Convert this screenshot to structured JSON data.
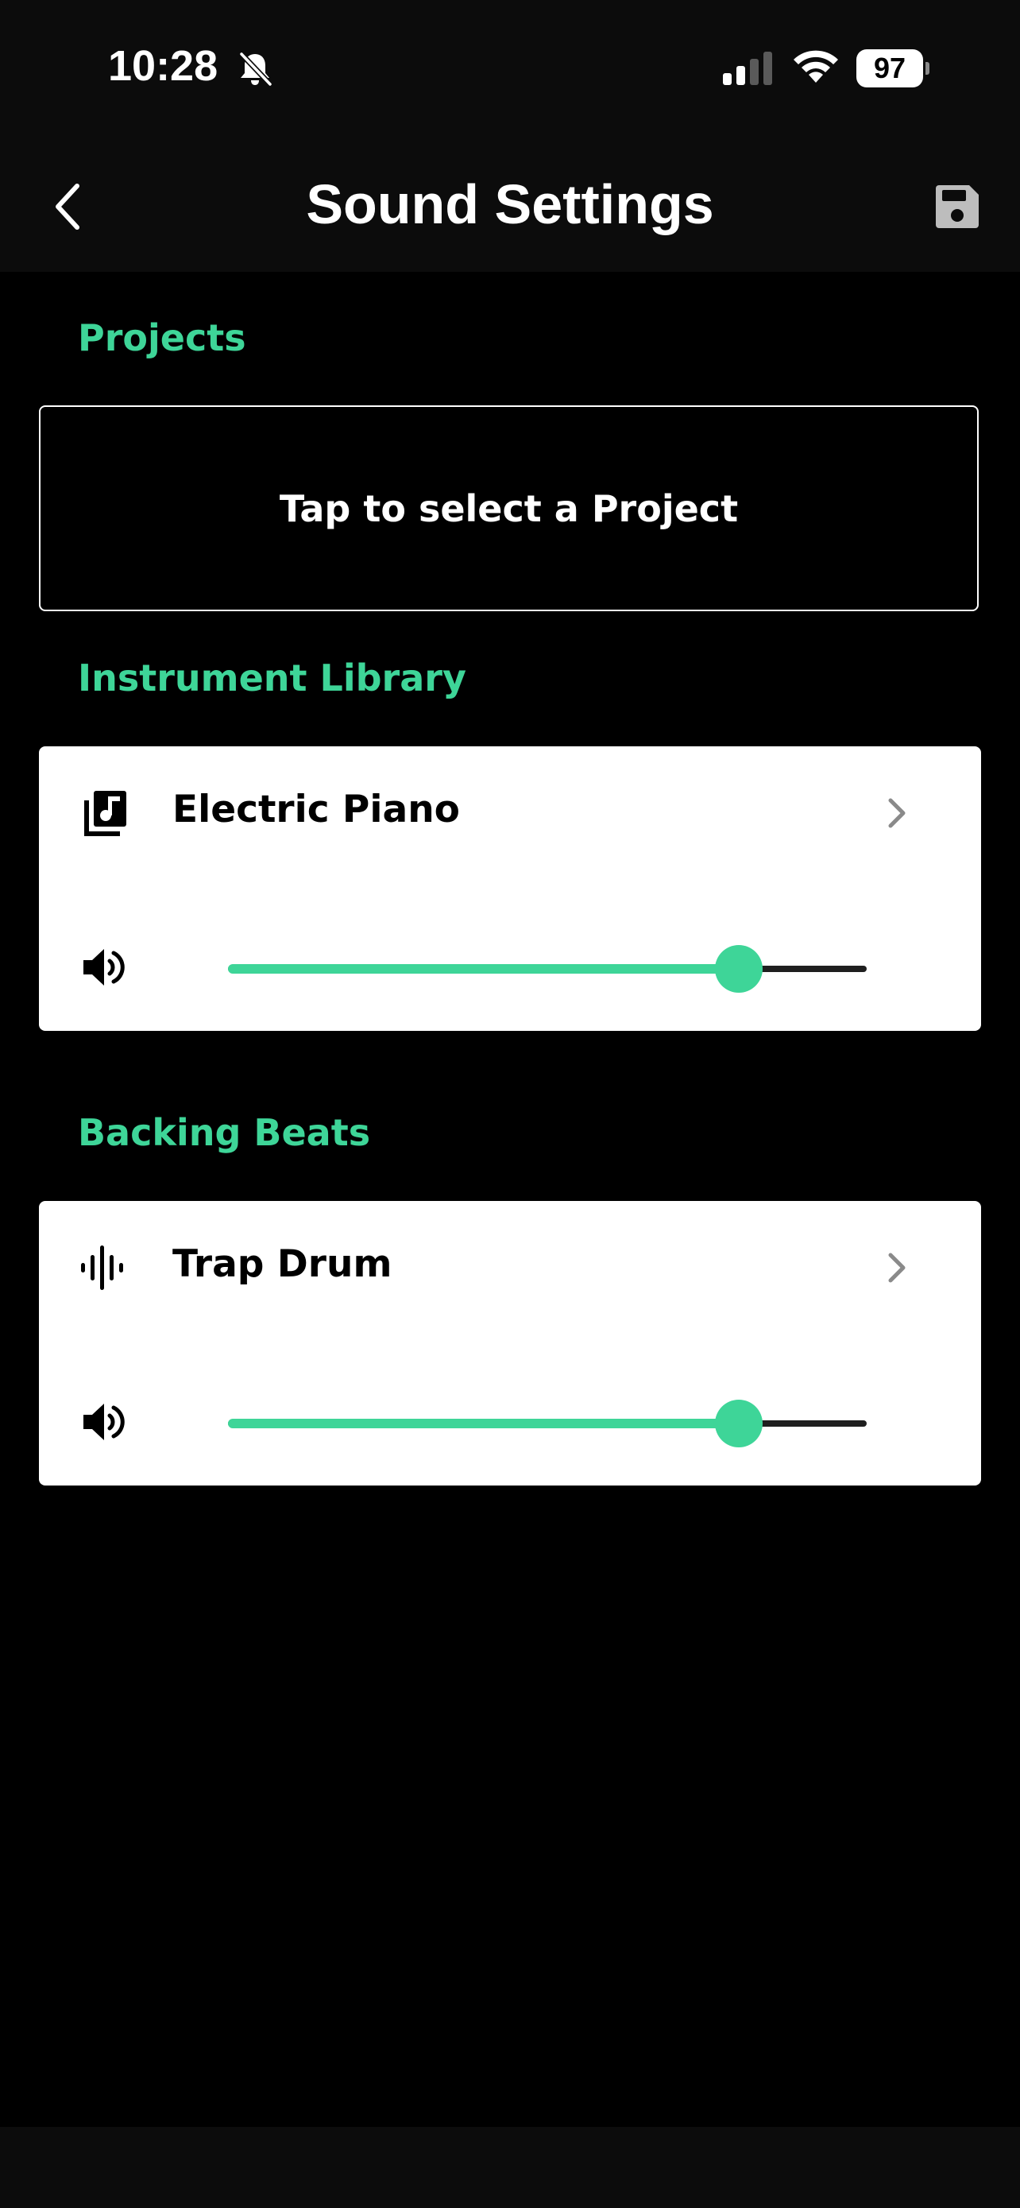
{
  "status_bar": {
    "time": "10:28",
    "battery": "97",
    "icons": [
      "bell-slash-icon",
      "cellular-signal-icon",
      "wifi-icon",
      "battery-icon"
    ]
  },
  "nav": {
    "title": "Sound Settings",
    "back_icon": "chevron-left-icon",
    "save_icon": "floppy-disk-icon"
  },
  "projects": {
    "header": "Projects",
    "select_label": "Tap to select a Project"
  },
  "instrument": {
    "header": "Instrument Library",
    "name": "Electric Piano",
    "icon": "music-library-icon",
    "volume": 0.8
  },
  "beats": {
    "header": "Backing Beats",
    "name": "Trap Drum",
    "icon": "waveform-icon",
    "volume": 0.8
  },
  "colors": {
    "accent": "#3ed598",
    "background": "#000000",
    "bar_background": "#0c0c0c",
    "card": "#ffffff"
  }
}
